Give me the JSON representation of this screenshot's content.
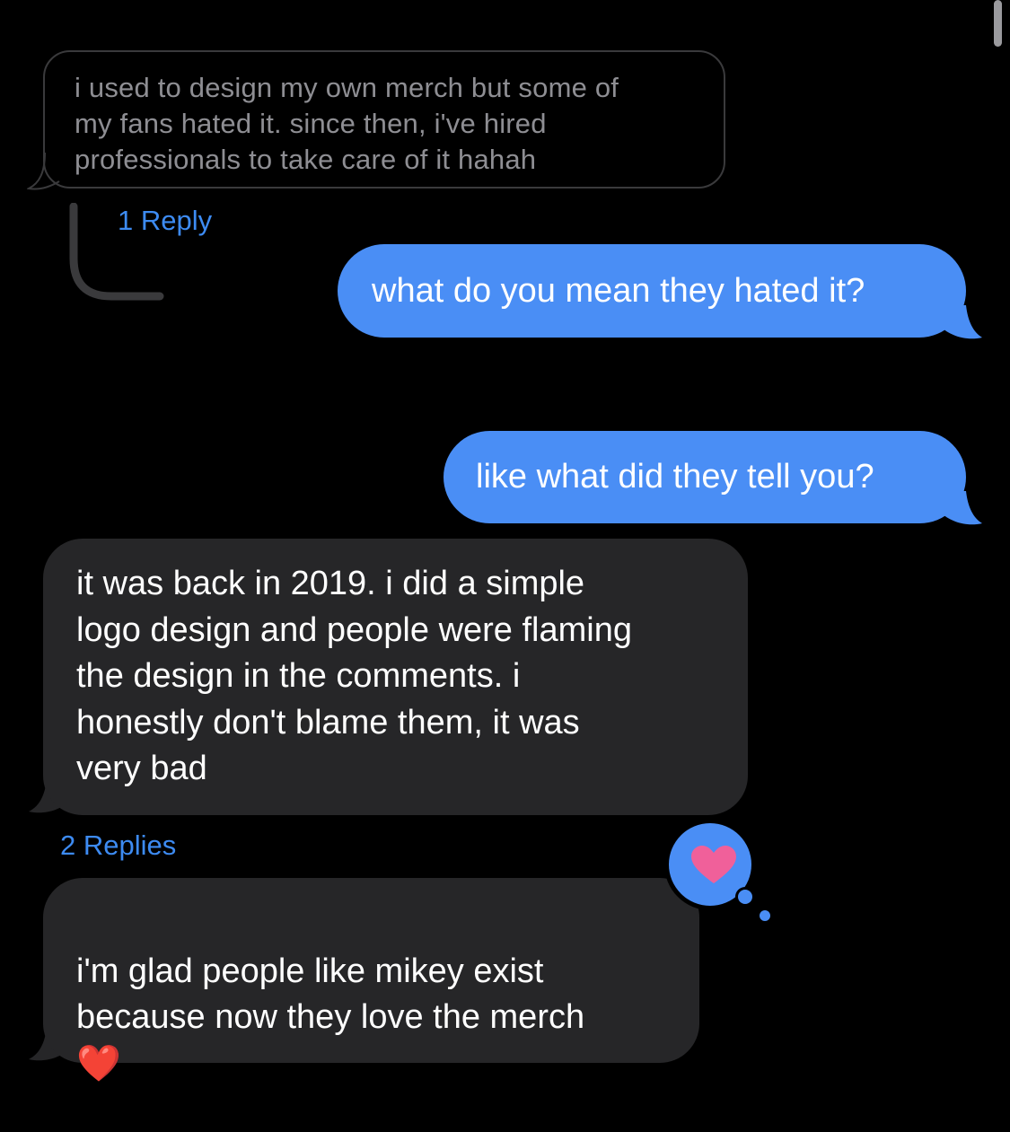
{
  "messages": {
    "quoted": {
      "text": "i used to design my own merch but some of\nmy fans hated it. since then, i've hired\nprofessionals to take care of it hahah"
    },
    "quoted_replies": "1 Reply",
    "out1": {
      "text": "what do you mean they hated it?"
    },
    "out2": {
      "text": "like what did they tell you?"
    },
    "in1": {
      "text": "it was back in 2019. i did a simple\nlogo design and people were flaming\nthe design in the comments. i\nhonestly don't blame them, it was\nvery bad"
    },
    "in1_replies": "2 Replies",
    "in1_reaction": "heart",
    "in2": {
      "text": "i'm glad people like mikey exist\nbecause now they love the merch",
      "emoji": "❤️"
    }
  },
  "colors": {
    "background": "#000000",
    "outgoing_bubble": "#4a8ef5",
    "incoming_bubble": "#262628",
    "link": "#3d8bf2",
    "reaction_heart": "#f0609a"
  }
}
